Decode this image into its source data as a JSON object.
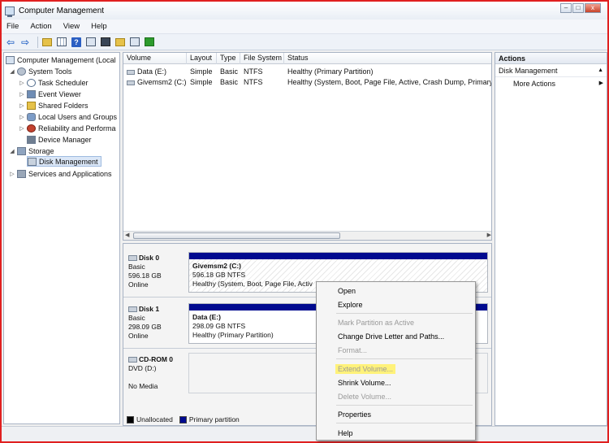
{
  "window": {
    "title": "Computer Management",
    "controls": {
      "minimize": "–",
      "maximize": "□",
      "close": "x"
    }
  },
  "menu": [
    "File",
    "Action",
    "View",
    "Help"
  ],
  "toolbar": {
    "icons": [
      "back-arrow-icon",
      "forward-arrow-icon",
      "up-folder-icon",
      "show-hide-tree-icon",
      "help-icon",
      "properties-icon",
      "settings-icon",
      "open-folder-icon",
      "search-icon",
      "refresh-icon"
    ]
  },
  "tree": {
    "root": "Computer Management (Local",
    "system_tools": "System Tools",
    "task_scheduler": "Task Scheduler",
    "event_viewer": "Event Viewer",
    "shared_folders": "Shared Folders",
    "local_users": "Local Users and Groups",
    "reliability": "Reliability and Performa",
    "device_manager": "Device Manager",
    "storage": "Storage",
    "disk_management": "Disk Management",
    "services": "Services and Applications"
  },
  "volume_table": {
    "columns": [
      "Volume",
      "Layout",
      "Type",
      "File System",
      "Status"
    ],
    "rows": [
      {
        "volume": "Data (E:)",
        "layout": "Simple",
        "type": "Basic",
        "fs": "NTFS",
        "status": "Healthy (Primary Partition)"
      },
      {
        "volume": "Givemsm2 (C:)",
        "layout": "Simple",
        "type": "Basic",
        "fs": "NTFS",
        "status": "Healthy (System, Boot, Page File, Active, Crash Dump, Primary"
      }
    ]
  },
  "disks": [
    {
      "name": "Disk 0",
      "type": "Basic",
      "size": "596.18 GB",
      "state": "Online",
      "partition": {
        "title": "Givemsm2  (C:)",
        "size": "596.18 GB NTFS",
        "status": "Healthy (System, Boot, Page File, Activ"
      }
    },
    {
      "name": "Disk 1",
      "type": "Basic",
      "size": "298.09 GB",
      "state": "Online",
      "partition": {
        "title": "Data  (E:)",
        "size": "298.09 GB NTFS",
        "status": "Healthy (Primary Partition)"
      }
    },
    {
      "name": "CD-ROM 0",
      "type": "DVD (D:)",
      "state": "No Media"
    }
  ],
  "legend": {
    "unallocated": "Unallocated",
    "primary": "Primary partition"
  },
  "colors": {
    "unallocated": "#000000",
    "primary": "#000a8f",
    "highlight": "#fff27a"
  },
  "actions": {
    "header": "Actions",
    "section": "Disk Management",
    "more": "More Actions"
  },
  "context_menu": {
    "open": "Open",
    "explore": "Explore",
    "mark_active": "Mark Partition as Active",
    "change_letter": "Change Drive Letter and Paths...",
    "format": "Format...",
    "extend": "Extend Volume...",
    "shrink": "Shrink Volume...",
    "delete": "Delete Volume...",
    "properties": "Properties",
    "help": "Help"
  }
}
